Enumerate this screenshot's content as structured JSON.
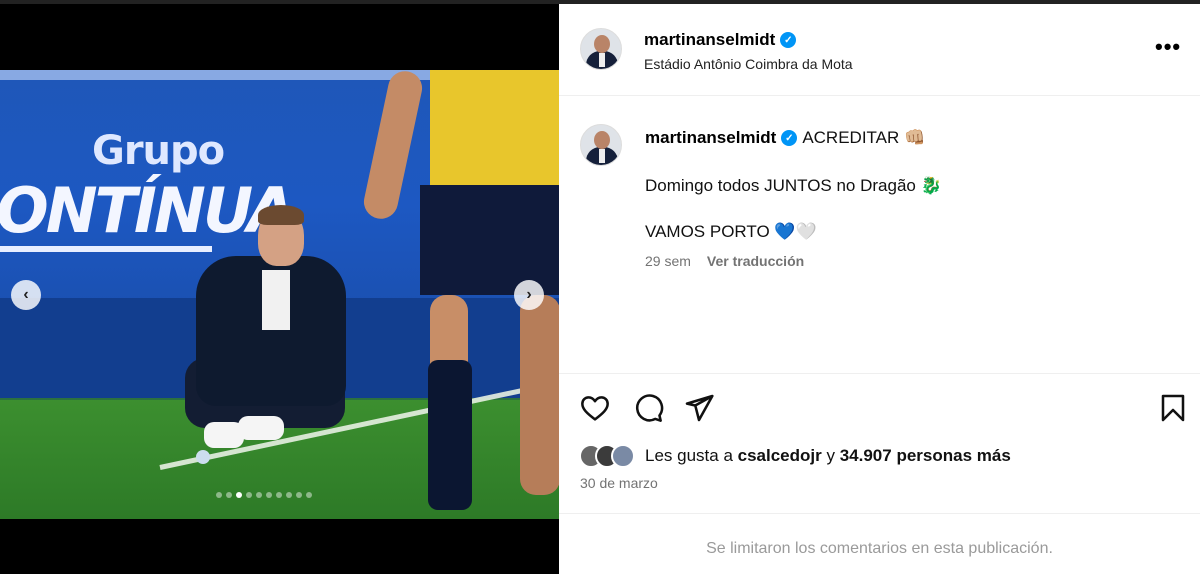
{
  "post": {
    "username": "martinanselmidt",
    "location": "Estádio Antônio Coimbra da Mota",
    "more_label": "•••"
  },
  "media": {
    "ad_text_line1": "Grupo",
    "ad_text_line2": "ONTÍNUA",
    "prev_label": "‹",
    "next_label": "›",
    "slide_count": 10,
    "active_slide": 3
  },
  "caption": {
    "username": "martinanselmidt",
    "line1": "ACREDITAR 👊🏼",
    "line2": "Domingo todos JUNTOS no Dragão 🐉",
    "line3": "VAMOS PORTO 💙🤍",
    "time": "29 sem",
    "translate": "Ver traducción"
  },
  "actions": {
    "like_icon": "heart-icon",
    "comment_icon": "comment-icon",
    "share_icon": "send-icon",
    "save_icon": "bookmark-icon"
  },
  "likes": {
    "prefix": "Les gusta a",
    "user": "csalcedojr",
    "joiner": "y",
    "count": "34.907 personas más"
  },
  "date": "30 de marzo",
  "comments_notice": "Se limitaron los comentarios en esta publicación.",
  "colors": {
    "verified": "#0095f6",
    "secondary_text": "#737373"
  }
}
